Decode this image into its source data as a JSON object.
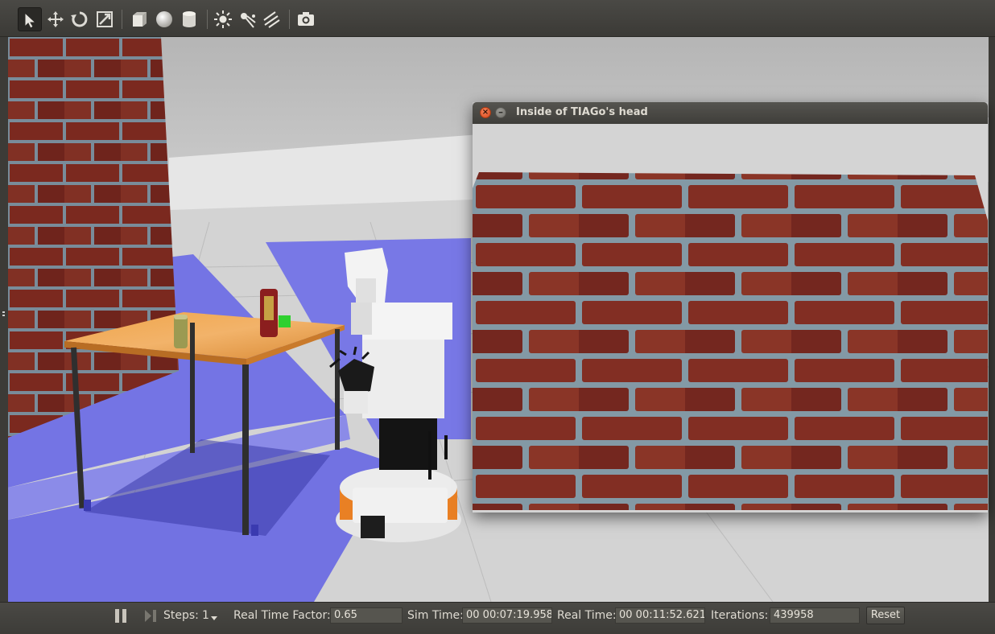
{
  "toolbar": {
    "tools": [
      {
        "icon": "select-arrow-icon",
        "active": true
      },
      {
        "icon": "translate-icon"
      },
      {
        "icon": "rotate-icon"
      },
      {
        "icon": "scale-icon"
      },
      {
        "icon": "box-shape-icon"
      },
      {
        "icon": "sphere-shape-icon"
      },
      {
        "icon": "cylinder-shape-icon"
      },
      {
        "icon": "point-light-icon"
      },
      {
        "icon": "spot-light-icon"
      },
      {
        "icon": "directional-light-icon"
      },
      {
        "icon": "screenshot-camera-icon"
      }
    ]
  },
  "camera_window": {
    "title": "Inside of TIAGo's head",
    "close_glyph": "×",
    "minimize_glyph": "–"
  },
  "scene": {
    "objects": [
      "brick-wall",
      "table",
      "pringles-can",
      "beer-can",
      "green-cube",
      "tiago-robot"
    ],
    "floor_color": "#d3d3d3",
    "laser_color": "#7474e4",
    "brick_color": "#8a2f22",
    "mortar_color": "#8aa0b0",
    "table_top_color": "#e79a3c",
    "robot_base_accent": "#e07818"
  },
  "status": {
    "steps_label": "Steps:",
    "steps_value": "1",
    "rtf_label": "Real Time Factor:",
    "rtf_value": "0.65",
    "sim_time_label": "Sim Time:",
    "sim_time_value": "00 00:07:19.958",
    "real_time_label": "Real Time:",
    "real_time_value": "00 00:11:52.621",
    "iterations_label": "Iterations:",
    "iterations_value": "439958",
    "reset_label": "Reset"
  }
}
